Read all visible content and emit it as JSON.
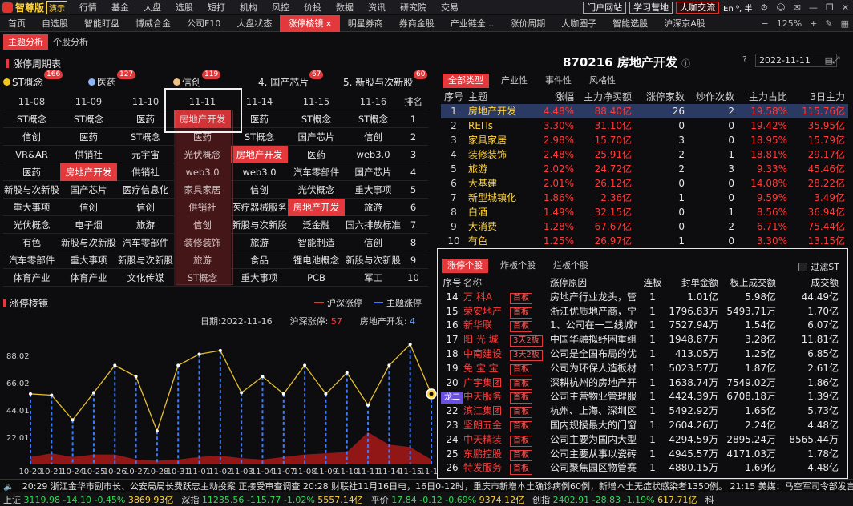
{
  "app": {
    "brand": "智尊版",
    "demo": "演示"
  },
  "menu": [
    "行情",
    "基金",
    "大盘",
    "选股",
    "短打",
    "机构",
    "风控",
    "价投",
    "数据",
    "资讯",
    "研究院",
    "交易"
  ],
  "top_buttons": [
    "门户网站",
    "学习营地",
    "大咖交流"
  ],
  "top_right_extra": "En ⁰, 半",
  "tabs": [
    "首页",
    "自选股",
    "智能盯盘",
    "博威合金",
    "公司F10",
    "大盘状态",
    "涨停棱镜",
    "明星券商",
    "券商金股",
    "产业链全...",
    "涨价周期",
    "大咖圈子",
    "智能选股",
    "沪深京A股"
  ],
  "zoom": "125%",
  "subtabs": [
    "主题分析",
    "个股分析"
  ],
  "cycle": {
    "title": "涨停周期表",
    "themes": [
      {
        "label": "ST概念",
        "count": "166",
        "color": "#f5c518"
      },
      {
        "label": "医药",
        "count": "127",
        "color": "#8ab4f8"
      },
      {
        "label": "信创",
        "count": "119",
        "color": "#f0c080"
      },
      {
        "label": "4. 国产芯片",
        "count": "67",
        "color": ""
      },
      {
        "label": "5. 新股与次新股",
        "count": "60",
        "color": ""
      }
    ],
    "dates": [
      "11-08",
      "11-09",
      "11-10",
      "11-11",
      "11-14",
      "11-15",
      "11-16"
    ],
    "rank_label": "排名",
    "rows": [
      [
        "ST概念",
        "ST概念",
        "医药",
        "房地产开发",
        "医药",
        "ST概念",
        "ST概念",
        "1"
      ],
      [
        "信创",
        "医药",
        "ST概念",
        "医药",
        "ST概念",
        "国产芯片",
        "信创",
        "2"
      ],
      [
        "VR&AR",
        "供销社",
        "元宇宙",
        "光伏概念",
        "房地产开发",
        "医药",
        "web3.0",
        "3"
      ],
      [
        "医药",
        "房地产开发",
        "供销社",
        "web3.0",
        "web3.0",
        "汽车零部件",
        "国产芯片",
        "4"
      ],
      [
        "新股与次新股",
        "国产芯片",
        "医疗信息化",
        "家具家居",
        "信创",
        "光伏概念",
        "重大事项",
        "5"
      ],
      [
        "重大事项",
        "信创",
        "信创",
        "供销社",
        "医疗器械服务",
        "房地产开发",
        "旅游",
        "6"
      ],
      [
        "光伏概念",
        "电子烟",
        "旅游",
        "信创",
        "新股与次新股",
        "泛金融",
        "国六排放标准",
        "7"
      ],
      [
        "有色",
        "新股与次新股",
        "汽车零部件",
        "装修装饰",
        "旅游",
        "智能制造",
        "信创",
        "8"
      ],
      [
        "汽车零部件",
        "重大事项",
        "新股与次新股",
        "旅游",
        "食品",
        "锂电池概念",
        "新股与次新股",
        "9"
      ],
      [
        "体育产业",
        "体育产业",
        "文化传媒",
        "ST概念",
        "重大事项",
        "PCB",
        "军工",
        "10"
      ]
    ]
  },
  "prism": {
    "title": "涨停棱镜",
    "legend": [
      "沪深涨停",
      "主题涨停"
    ],
    "info": {
      "date_label": "日期:",
      "date": "2022-11-16",
      "market_label": "沪深涨停:",
      "market": "57",
      "theme_label": "房地产开发:",
      "theme": "4"
    }
  },
  "chart_data": {
    "type": "line",
    "x": [
      "10-20",
      "10-21",
      "10-24",
      "10-25",
      "10-26",
      "10-27",
      "10-28",
      "10-31",
      "11-01",
      "11-02",
      "11-03",
      "11-04",
      "11-07",
      "11-08",
      "11-09",
      "11-10",
      "11-11",
      "11-14",
      "11-15",
      "11-16"
    ],
    "yticks": [
      "22.01",
      "44.01",
      "66.02",
      "88.02"
    ],
    "ylim": [
      0,
      110
    ],
    "series": [
      {
        "name": "沪深涨停",
        "type": "area",
        "color": "#a01818",
        "values": [
          6,
          9,
          6,
          8,
          8,
          4,
          3,
          4,
          6,
          7,
          5,
          4,
          6,
          8,
          9,
          10,
          26,
          16,
          14,
          4
        ]
      },
      {
        "name": "主题涨停",
        "type": "line",
        "color": "#e6c030",
        "values": [
          57,
          56,
          36,
          58,
          80,
          71,
          27,
          80,
          89,
          92,
          58,
          71,
          57,
          80,
          57,
          74,
          48,
          80,
          97,
          57
        ]
      }
    ]
  },
  "right_head": {
    "code_name": "870216 房地产开发",
    "date": "2022-11-11"
  },
  "sector_tabs": [
    "全部类型",
    "产业性",
    "事件性",
    "风格性"
  ],
  "sector_headers": [
    "序号",
    "主题",
    "涨幅",
    "主力净买额",
    "涨停家数",
    "炒作次数",
    "主力占比",
    "3日主力"
  ],
  "sectors": [
    [
      "1",
      "房地产开发",
      "4.48%",
      "88.40亿",
      "26",
      "2",
      "19.58%",
      "115.76亿"
    ],
    [
      "2",
      "REITs",
      "3.30%",
      "31.10亿",
      "0",
      "0",
      "19.42%",
      "35.95亿"
    ],
    [
      "3",
      "家具家居",
      "2.98%",
      "15.70亿",
      "3",
      "0",
      "18.95%",
      "15.79亿"
    ],
    [
      "4",
      "装修装饰",
      "2.48%",
      "25.91亿",
      "2",
      "1",
      "18.81%",
      "29.17亿"
    ],
    [
      "5",
      "旅游",
      "2.02%",
      "24.72亿",
      "2",
      "3",
      "9.33%",
      "45.46亿"
    ],
    [
      "6",
      "大基建",
      "2.01%",
      "26.12亿",
      "0",
      "0",
      "14.08%",
      "28.22亿"
    ],
    [
      "7",
      "新型城镇化",
      "1.86%",
      "2.36亿",
      "1",
      "0",
      "9.59%",
      "3.49亿"
    ],
    [
      "8",
      "白酒",
      "1.49%",
      "32.15亿",
      "0",
      "1",
      "8.56%",
      "36.94亿"
    ],
    [
      "9",
      "大消费",
      "1.28%",
      "67.67亿",
      "0",
      "2",
      "6.71%",
      "75.44亿"
    ],
    [
      "10",
      "有色",
      "1.25%",
      "26.97亿",
      "1",
      "0",
      "3.30%",
      "13.15亿"
    ]
  ],
  "stock_tabs": [
    "涨停个股",
    "炸板个股",
    "烂板个股"
  ],
  "filter_label": "过滤ST",
  "stock_headers": [
    "序号",
    "名称",
    "",
    "涨停原因",
    "连板",
    "封单金额",
    "板上成交额",
    "成交额"
  ],
  "stocks": [
    [
      "14",
      "万 科A",
      "首板",
      "房地产行业龙头，管...",
      "1",
      "1.01亿",
      "5.98亿",
      "44.49亿"
    ],
    [
      "15",
      "荣安地产",
      "首板",
      "浙江优质地产商，宁...",
      "1",
      "1796.83万",
      "5493.71万",
      "1.70亿"
    ],
    [
      "16",
      "新华联",
      "首板",
      "1、公司在一二线城市...",
      "1",
      "7527.94万",
      "1.54亿",
      "6.07亿"
    ],
    [
      "17",
      "阳 光 城",
      "3天2板",
      "中国华融拟纾困重组...",
      "1",
      "1948.87万",
      "3.28亿",
      "11.81亿"
    ],
    [
      "18",
      "中南建设",
      "3天2板",
      "公司是全国布局的优...",
      "1",
      "413.05万",
      "1.25亿",
      "6.85亿"
    ],
    [
      "19",
      "免 宝 宝",
      "首板",
      "公司为环保人造板材...",
      "1",
      "5023.57万",
      "1.87亿",
      "2.61亿"
    ],
    [
      "20",
      "广宇集团",
      "首板",
      "深耕杭州的房地产开...",
      "1",
      "1638.74万",
      "7549.02万",
      "1.86亿"
    ],
    [
      "21",
      "中天服务",
      "首板",
      "公司主营物业管理服...",
      "1",
      "4424.39万",
      "6708.18万",
      "1.39亿"
    ],
    [
      "22",
      "滨江集团",
      "首板",
      "杭州、上海、深圳区...",
      "1",
      "5492.92万",
      "1.65亿",
      "5.73亿"
    ],
    [
      "23",
      "坚朗五金",
      "首板",
      "国内规模最大的门窗...",
      "1",
      "2604.26万",
      "2.24亿",
      "4.48亿"
    ],
    [
      "24",
      "中天精装",
      "首板",
      "公司主要为国内大型...",
      "1",
      "4294.59万",
      "2895.24万",
      "8565.44万"
    ],
    [
      "25",
      "东鹏控股",
      "首板",
      "公司主要从事以瓷砖...",
      "1",
      "4945.57万",
      "4171.03万",
      "1.78亿"
    ],
    [
      "26",
      "特发服务",
      "首板",
      "公司聚焦园区物管赛...",
      "1",
      "4880.15万",
      "1.69亿",
      "4.48亿"
    ]
  ],
  "dragon_tag": "龙二",
  "ticker": "20:29 浙江金华市副市长、公安局局长费跃忠主动投案 正接受审查调查          20:28 财联社11月16日电，16日0-12时，重庆市新增本土确诊病例60例，新增本土无症状感染者1350例。          21:15 美媒：马空军司令部发言人称将",
  "status": {
    "sh_label": "上证",
    "sh": "3119.98",
    "sh_chg": "-14.10",
    "sh_pct": "-0.45%",
    "sh_amt": "3869.93亿",
    "sz_label": "深指",
    "sz": "11235.56",
    "sz_chg": "-115.77",
    "sz_pct": "-1.02%",
    "sz_amt": "5557.14亿",
    "pj_label": "平价",
    "pj": "17.84",
    "pj_chg": "-0.12",
    "pj_pct": "-0.69%",
    "pj_amt": "9374.12亿",
    "cy_label": "创指",
    "cy": "2402.91",
    "cy_chg": "-28.83",
    "cy_pct": "-1.19%",
    "cy_amt": "617.71亿",
    "cy_end": "科"
  }
}
